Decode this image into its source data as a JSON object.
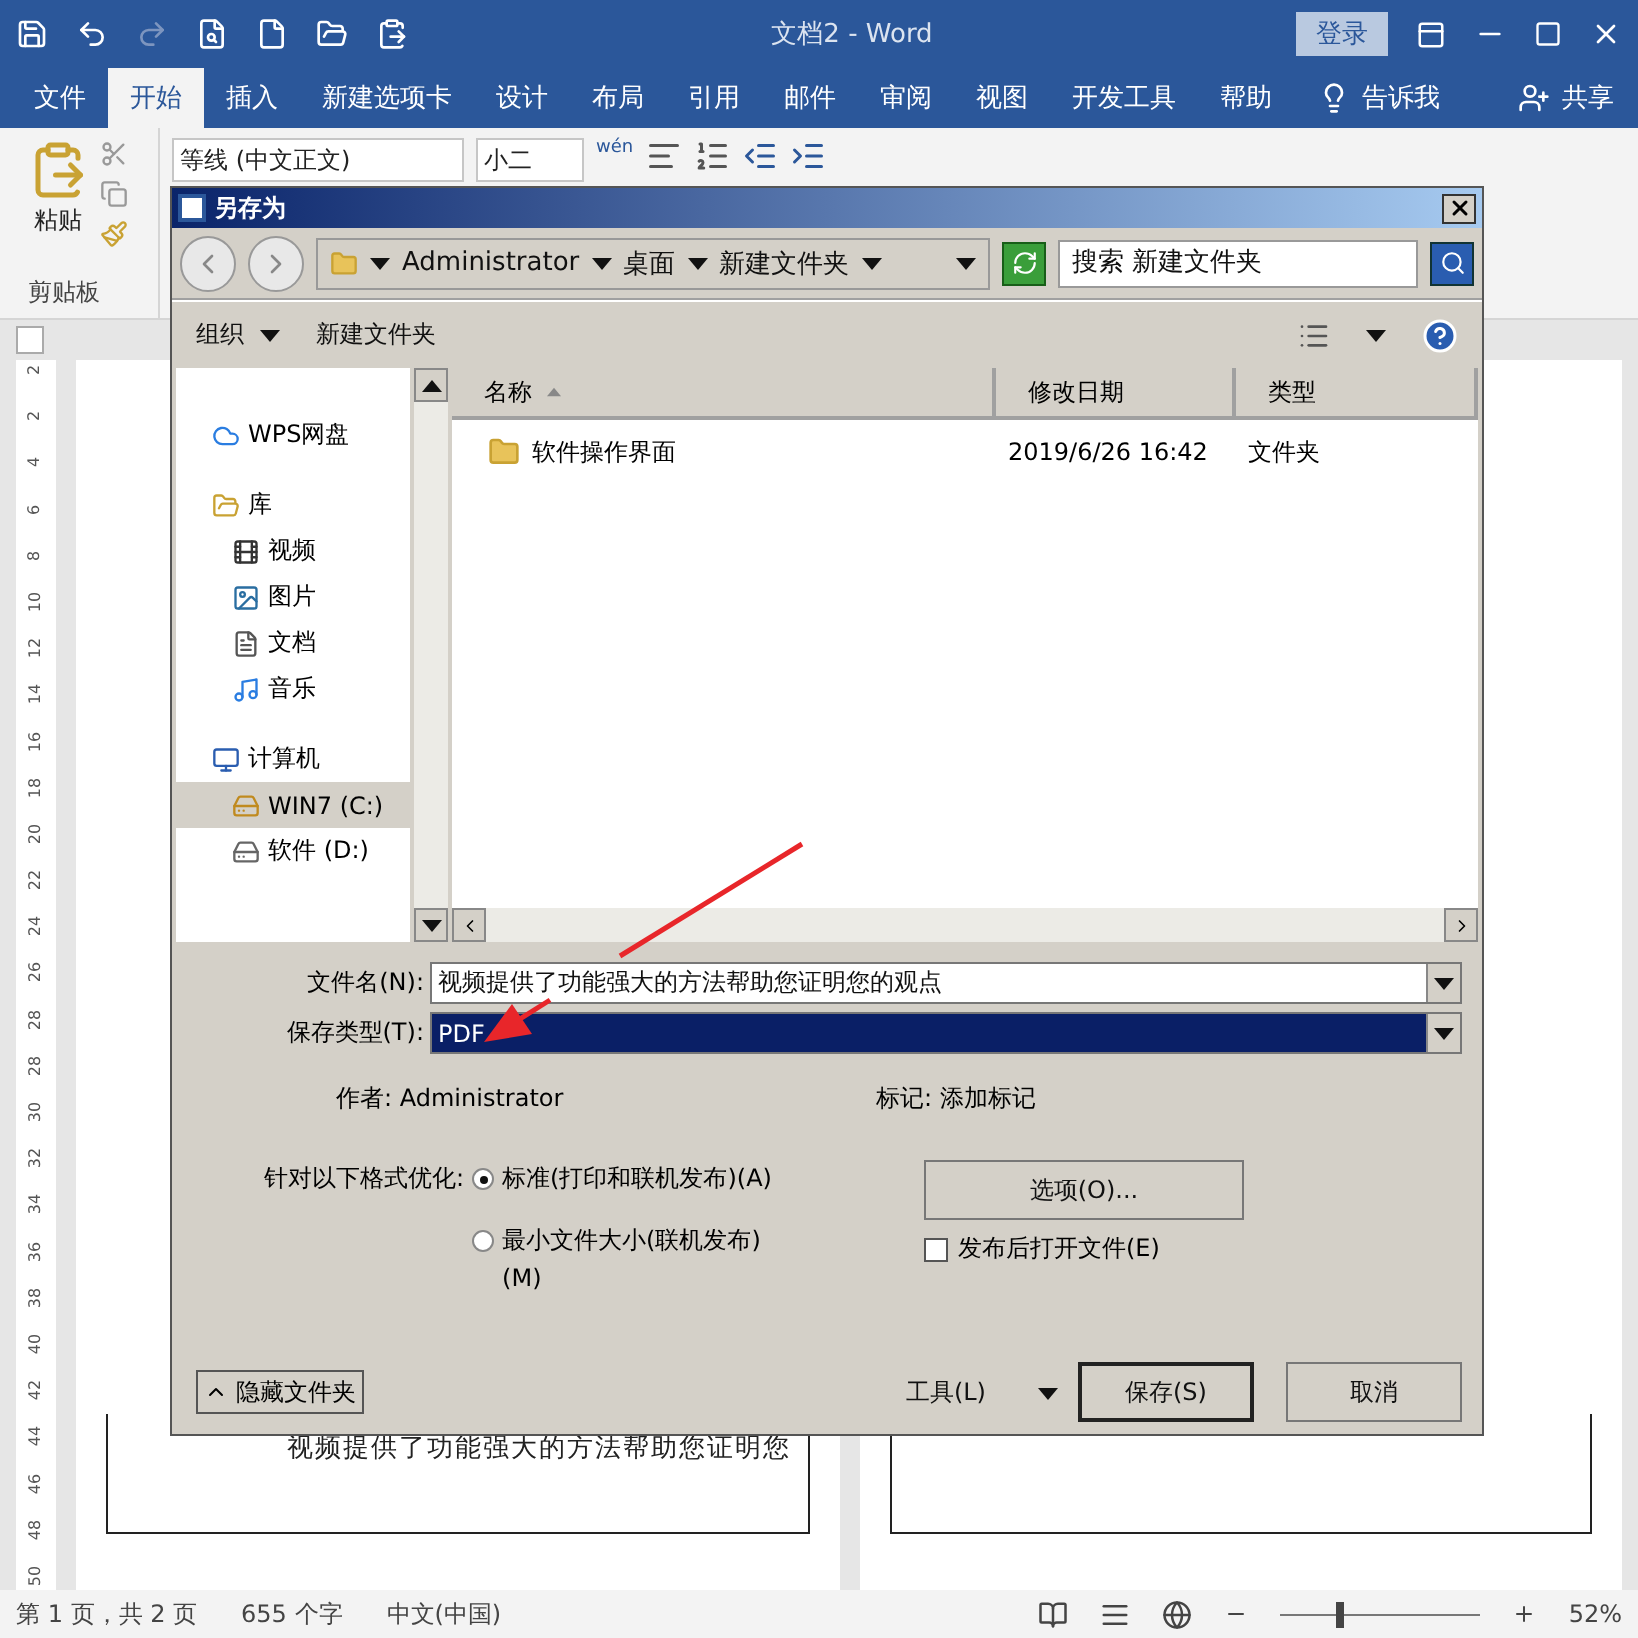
{
  "word": {
    "title": "文档2 - Word",
    "login": "登录",
    "tabs": [
      {
        "label": "文件",
        "selected": false
      },
      {
        "label": "开始",
        "selected": true
      },
      {
        "label": "插入",
        "selected": false
      },
      {
        "label": "新建选项卡",
        "selected": false
      },
      {
        "label": "设计",
        "selected": false
      },
      {
        "label": "布局",
        "selected": false
      },
      {
        "label": "引用",
        "selected": false
      },
      {
        "label": "邮件",
        "selected": false
      },
      {
        "label": "审阅",
        "selected": false
      },
      {
        "label": "视图",
        "selected": false
      },
      {
        "label": "开发工具",
        "selected": false
      },
      {
        "label": "帮助",
        "selected": false
      }
    ],
    "tell_me": "告诉我",
    "share": "共享",
    "ribbon": {
      "paste": "粘贴",
      "clipboard": "剪贴板",
      "font": "等线 (中文正文)",
      "size": "小二",
      "phonetic": "wén"
    },
    "ruler": [
      "2",
      "2",
      "4",
      "6",
      "8",
      "10",
      "12",
      "14",
      "16",
      "18",
      "20",
      "22",
      "24",
      "26",
      "28",
      "28",
      "30",
      "32",
      "34",
      "36",
      "38",
      "40",
      "42",
      "44",
      "46",
      "48",
      "50"
    ],
    "page_text": "视频提供了功能强大的方法帮助您证明您",
    "status_bar": {
      "page": "第 1 页，共 2 页",
      "words": "655 个字",
      "language": "中文(中国)",
      "zoom": "52%",
      "level": 0.28
    }
  },
  "dialog": {
    "title": "另存为",
    "crumbs": [
      "Administrator",
      "桌面",
      "新建文件夹"
    ],
    "search": {
      "placeholder": "搜索 新建文件夹"
    },
    "toolbar": {
      "organize": "组织",
      "new_folder": "新建文件夹"
    },
    "nav": [
      {
        "kind": "cloud",
        "label": "WPS网盘",
        "selected": false
      },
      {
        "kind": "library",
        "label": "库",
        "selected": false,
        "children": [
          {
            "kind": "video",
            "label": "视频",
            "selected": false
          },
          {
            "kind": "picture",
            "label": "图片",
            "selected": false
          },
          {
            "kind": "document",
            "label": "文档",
            "selected": false
          },
          {
            "kind": "music",
            "label": "音乐",
            "selected": false
          }
        ]
      },
      {
        "kind": "computer",
        "label": "计算机",
        "selected": false,
        "children": [
          {
            "kind": "system-drive",
            "label": "WIN7 (C:)",
            "selected": true
          },
          {
            "kind": "drive",
            "label": "软件 (D:)",
            "selected": false
          }
        ]
      }
    ],
    "columns": [
      "名称",
      "修改日期",
      "类型"
    ],
    "rows": [
      {
        "name": "软件操作界面",
        "date": "2019/6/26 16:42",
        "type": "文件夹"
      }
    ],
    "file_name_label": "文件名(N):",
    "file_name": "视频提供了功能强大的方法帮助您证明您的观点",
    "type_label": "保存类型(T):",
    "type_value": "PDF",
    "author_label": "作者:",
    "author": "Administrator",
    "tags_label": "标记:",
    "tags": "添加标记",
    "optimize_label": "针对以下格式优化:",
    "options": [
      {
        "label": "标准(打印和联机发布)(A)",
        "selected": true
      },
      {
        "label": "最小文件大小(联机发布)(M)",
        "selected": false
      }
    ],
    "options_button": "选项(O)...",
    "open_after": {
      "label": "发布后打开文件(E)",
      "checked": false
    },
    "hide_folders": "隐藏文件夹",
    "tools": "工具(L)",
    "save": "保存(S)",
    "cancel": "取消"
  }
}
